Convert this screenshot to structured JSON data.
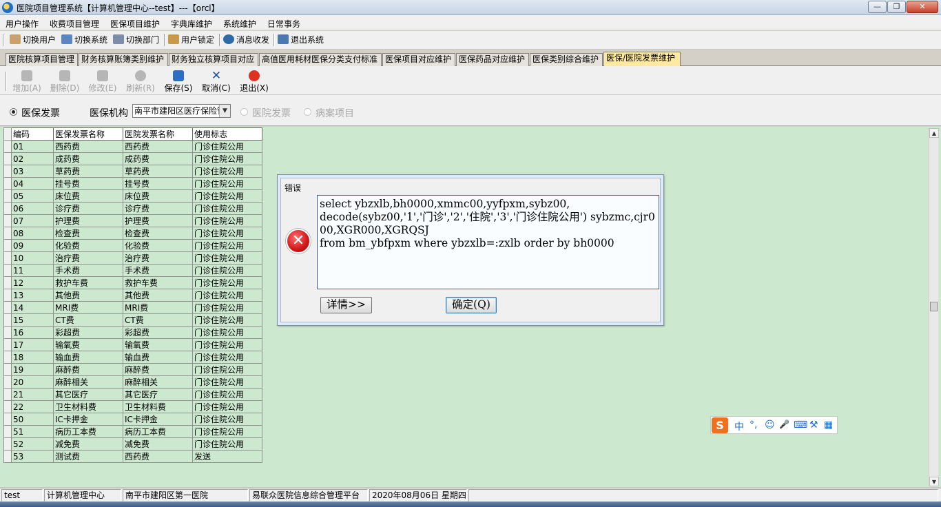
{
  "window": {
    "title": "医院项目管理系统【计算机管理中心--test】---【orcl】",
    "min_symbol": "—",
    "max_symbol": "❐",
    "close_symbol": "✕"
  },
  "menu": [
    "用户操作",
    "收费项目管理",
    "医保项目维护",
    "字典库维护",
    "系统维护",
    "日常事务"
  ],
  "toolbar": [
    {
      "label": "切换用户",
      "icon": "user-switch-icon",
      "color": "#c9a36b"
    },
    {
      "label": "切换系统",
      "icon": "system-switch-icon",
      "color": "#5a86c4"
    },
    {
      "label": "切换部门",
      "icon": "department-switch-icon",
      "color": "#7b8da8"
    },
    {
      "label": "用户锁定",
      "icon": "user-lock-icon",
      "color": "#c79a4a"
    },
    {
      "label": "消息收发",
      "icon": "message-icon",
      "color": "#2f6aa8"
    },
    {
      "label": "退出系统",
      "icon": "exit-system-icon",
      "color": "#4a78b3"
    }
  ],
  "tabs": [
    {
      "label": "医院核算项目管理",
      "active": false
    },
    {
      "label": "财务核算账簿类别维护",
      "active": false
    },
    {
      "label": "财务独立核算项目对应",
      "active": false
    },
    {
      "label": "高值医用耗材医保分类支付标准",
      "active": false
    },
    {
      "label": "医保项目对应维护",
      "active": false
    },
    {
      "label": "医保药品对应维护",
      "active": false
    },
    {
      "label": "医保类别综合维护",
      "active": false
    },
    {
      "label": "医保/医院发票维护",
      "active": true
    }
  ],
  "actions": [
    {
      "label": "增加(A)",
      "icon": "add-icon",
      "enabled": false
    },
    {
      "label": "删除(D)",
      "icon": "delete-icon",
      "enabled": false
    },
    {
      "label": "修改(E)",
      "icon": "edit-icon",
      "enabled": false
    },
    {
      "label": "刷新(R)",
      "icon": "refresh-icon",
      "enabled": false
    },
    {
      "label": "保存(S)",
      "icon": "save-icon",
      "enabled": true,
      "color": "#2c6fc2"
    },
    {
      "label": "取消(C)",
      "icon": "cancel-icon",
      "enabled": true,
      "color": "#1c4fa0"
    },
    {
      "label": "退出(X)",
      "icon": "exit-icon",
      "enabled": true,
      "color": "#e03020"
    }
  ],
  "filter": {
    "radio_insurance": "医保发票",
    "org_label": "医保机构",
    "org_value": "南平市建阳区医疗保险管理中心",
    "radio_hospital": "医院发票",
    "radio_case": "病案项目"
  },
  "grid": {
    "columns": [
      "编码",
      "医保发票名称",
      "医院发票名称",
      "使用标志"
    ],
    "current_row": 27,
    "rows": [
      [
        "01",
        "西药费",
        "西药费",
        "门诊住院公用"
      ],
      [
        "02",
        "成药费",
        "成药费",
        "门诊住院公用"
      ],
      [
        "03",
        "草药费",
        "草药费",
        "门诊住院公用"
      ],
      [
        "04",
        "挂号费",
        "挂号费",
        "门诊住院公用"
      ],
      [
        "05",
        "床位费",
        "床位费",
        "门诊住院公用"
      ],
      [
        "06",
        "诊疗费",
        "诊疗费",
        "门诊住院公用"
      ],
      [
        "07",
        "护理费",
        "护理费",
        "门诊住院公用"
      ],
      [
        "08",
        "检查费",
        "检查费",
        "门诊住院公用"
      ],
      [
        "09",
        "化验费",
        "化验费",
        "门诊住院公用"
      ],
      [
        "10",
        "治疗费",
        "治疗费",
        "门诊住院公用"
      ],
      [
        "11",
        "手术费",
        "手术费",
        "门诊住院公用"
      ],
      [
        "12",
        "救护车费",
        "救护车费",
        "门诊住院公用"
      ],
      [
        "13",
        "其他费",
        "其他费",
        "门诊住院公用"
      ],
      [
        "14",
        "MRI费",
        "MRI费",
        "门诊住院公用"
      ],
      [
        "15",
        "CT费",
        "CT费",
        "门诊住院公用"
      ],
      [
        "16",
        "彩超费",
        "彩超费",
        "门诊住院公用"
      ],
      [
        "17",
        "输氧费",
        "输氧费",
        "门诊住院公用"
      ],
      [
        "18",
        "输血费",
        "输血费",
        "门诊住院公用"
      ],
      [
        "19",
        "麻醉费",
        "麻醉费",
        "门诊住院公用"
      ],
      [
        "20",
        "麻醉相关",
        "麻醉相关",
        "门诊住院公用"
      ],
      [
        "21",
        "其它医疗",
        "其它医疗",
        "门诊住院公用"
      ],
      [
        "22",
        "卫生材料费",
        "卫生材料费",
        "门诊住院公用"
      ],
      [
        "50",
        "IC卡押金",
        "IC卡押金",
        "门诊住院公用"
      ],
      [
        "51",
        "病历工本费",
        "病历工本费",
        "门诊住院公用"
      ],
      [
        "52",
        "减免费",
        "减免费",
        "门诊住院公用"
      ],
      [
        "53",
        "测试费",
        "西药费",
        "发送"
      ]
    ]
  },
  "dialog": {
    "title": "错误",
    "message": "select ybzxlb,bh0000,xmmc00,yyfpxm,sybz00,\ndecode(sybz00,'1','门诊','2','住院','3','门诊住院公用') sybzmc,cjr000,XGR000,XGRQSJ\nfrom bm_ybfpxm where ybzxlb=:zxlb order by bh0000",
    "details_button": "详情>>",
    "ok_button": "确定(Q)"
  },
  "ime": {
    "logo": "S",
    "mode": "中",
    "punct": "°,",
    "emoji": "☺",
    "mic": "🎤",
    "keyboard": "⌨",
    "tools": "⚒",
    "grid": "▦"
  },
  "status": {
    "user": "test",
    "department": "计算机管理中心",
    "hospital": "南平市建阳区第一医院",
    "platform": "易联众医院信息综合管理平台",
    "date": "2020年08月06日 星期四"
  }
}
